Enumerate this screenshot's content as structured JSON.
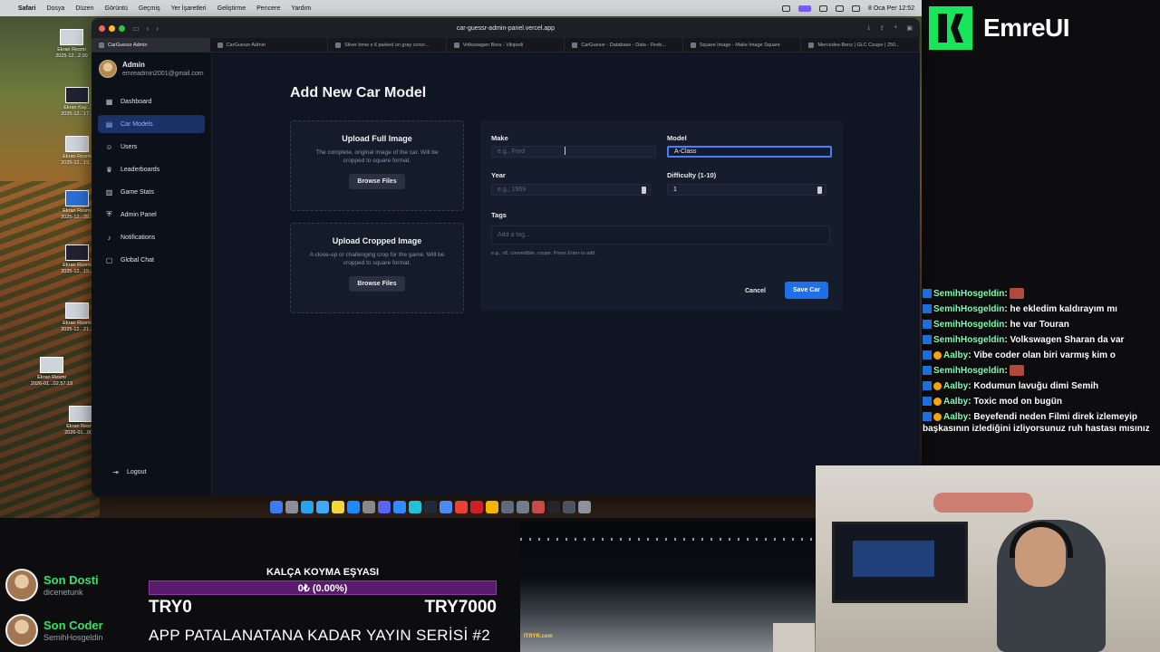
{
  "menubar": {
    "app": "Safari",
    "items": [
      "Dosya",
      "Düzen",
      "Görüntü",
      "Geçmiş",
      "Yer İşaretleri",
      "Geliştirme",
      "Pencere",
      "Yardım"
    ],
    "clock": "8 Oca Per 12:52"
  },
  "desktop_files": [
    {
      "name": "Ekran Resmi",
      "date": "2025-12...2.00"
    },
    {
      "name": "Ekran Kay...",
      "date": "2025-12...17..."
    },
    {
      "name": "Ekran Resmi",
      "date": "2025-12...19..."
    },
    {
      "name": "Ekran Resmi",
      "date": "2025-12...35..."
    },
    {
      "name": "Ekran Resmi",
      "date": "2025-12...15..."
    },
    {
      "name": "Ekran Resmi",
      "date": "2025-12...21..."
    },
    {
      "name": "Ekran Resmi",
      "date": "2026-01...02.57.19"
    },
    {
      "name": "Ekran Resmi",
      "date": "2026-01...00..."
    }
  ],
  "browser": {
    "url": "car-guessr-admin-panel.vercel.app",
    "tabs": [
      "CarGuessr Admin",
      "CarGuessr Admin",
      "Silver bmw x 6 parked on gray concr...",
      "Volkswagen Bora - Vikipedi",
      "CarGuessr - Database - Data - Fireb...",
      "Square Image - Make Image Square",
      "Mercedes-Benz | GLC Coupe | 250..."
    ]
  },
  "sidebar": {
    "user_name": "Admin",
    "user_email": "emreadmin2001@gmail.com",
    "items": [
      {
        "label": "Dashboard",
        "icon": "grid-icon"
      },
      {
        "label": "Car Models",
        "icon": "car-icon"
      },
      {
        "label": "Users",
        "icon": "users-icon"
      },
      {
        "label": "Leaderboards",
        "icon": "trophy-icon"
      },
      {
        "label": "Game Stats",
        "icon": "bar-chart-icon"
      },
      {
        "label": "Admin Panel",
        "icon": "shield-icon"
      },
      {
        "label": "Notifications",
        "icon": "bell-icon"
      },
      {
        "label": "Global Chat",
        "icon": "chat-icon"
      }
    ],
    "logout": "Logout"
  },
  "page": {
    "title": "Add New Car Model",
    "upload_full": {
      "title": "Upload Full Image",
      "desc": "The complete, original image of the car. Will be cropped to square format.",
      "button": "Browse Files"
    },
    "upload_cropped": {
      "title": "Upload Cropped Image",
      "desc": "A close-up or challenging crop for the game. Will be cropped to square format.",
      "button": "Browse Files"
    },
    "form": {
      "make_label": "Make",
      "make_placeholder": "e.g., Ford",
      "model_label": "Model",
      "model_value": "A-Class",
      "year_label": "Year",
      "year_placeholder": "e.g., 1969",
      "difficulty_label": "Difficulty (1-10)",
      "difficulty_value": "1",
      "tags_label": "Tags",
      "tags_placeholder": "Add a tag...",
      "tags_hint": "e.g., v8, convertible, coupe. Press Enter to add.",
      "cancel": "Cancel",
      "save": "Save Car"
    }
  },
  "stream": {
    "brand": "EmreUI",
    "chat": [
      {
        "user": "SemihHosgeldin",
        "msg": "",
        "mod": false,
        "emote": true
      },
      {
        "user": "SemihHosgeldin",
        "msg": "he ekledim kaldırayım mı",
        "mod": false,
        "emote": false
      },
      {
        "user": "SemihHosgeldin",
        "msg": "he var Touran",
        "mod": false,
        "emote": false
      },
      {
        "user": "SemihHosgeldin",
        "msg": "Volkswagen Sharan da var",
        "mod": false,
        "emote": false
      },
      {
        "user": "Aalby",
        "msg": "Vibe coder olan biri varmış kim o",
        "mod": true,
        "emote": false
      },
      {
        "user": "SemihHosgeldin",
        "msg": "",
        "mod": false,
        "emote": true
      },
      {
        "user": "Aalby",
        "msg": "Kodumun lavuğu dimi Semih",
        "mod": true,
        "emote": false
      },
      {
        "user": "Aalby",
        "msg": "Toxic mod on bugün",
        "mod": true,
        "emote": false
      },
      {
        "user": "Aalby",
        "msg": "Beyefendi neden Filmi direk izlemeyip başkasının izlediğini izliyorsunuz ruh hastası mısınız",
        "mod": true,
        "emote": false
      }
    ],
    "last_follower_title": "Son Dosti",
    "last_follower_name": "dicenetunk",
    "last_coder_title": "Son Coder",
    "last_coder_name": "SemihHosgeldin",
    "goal_title": "KALÇA KOYMA EŞYASI",
    "goal_progress_text": "0₺ (0.00%)",
    "goal_progress": 0.0,
    "goal_min": "TRY0",
    "goal_max": "TRY7000",
    "series_title": "APP PATALANATANA KADAR YAYIN SERİSİ #2",
    "clip_label": "ITRYR.com"
  }
}
